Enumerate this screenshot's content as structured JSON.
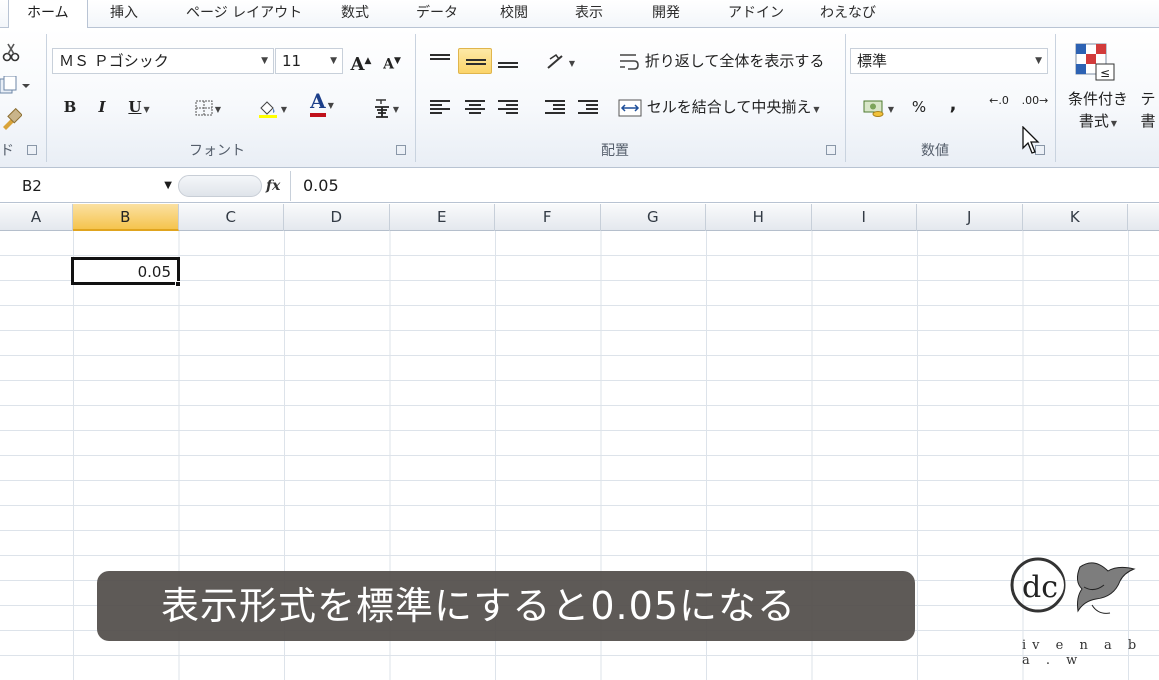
{
  "tabs": [
    "ホーム",
    "挿入",
    "ページ レイアウト",
    "数式",
    "データ",
    "校閲",
    "表示",
    "開発",
    "アドイン",
    "わえなび"
  ],
  "ribbon": {
    "clipboard_label": "ド",
    "font": {
      "name": "ＭＳ Ｐゴシック",
      "size": "11",
      "group_label": "フォント",
      "bold": "B",
      "italic": "I",
      "underline": "U",
      "font_color_letter": "A",
      "grow": "A",
      "shrink": "A"
    },
    "alignment": {
      "wrap_text": "折り返して全体を表示する",
      "merge_center": "セルを結合して中央揃え",
      "group_label": "配置"
    },
    "number": {
      "format": "標準",
      "percent": "%",
      "comma": ",",
      "group_label": "数値",
      "inc_decimal": ".0",
      "dec_decimal": ".00"
    },
    "styles": {
      "conditional_line1": "条件付き",
      "conditional_line2": "書式",
      "table_partial": "テ",
      "table_partial2": "書"
    }
  },
  "formula_bar": {
    "name_box": "B2",
    "fx": "fx",
    "formula": "0.05"
  },
  "columns": [
    "A",
    "B",
    "C",
    "D",
    "E",
    "F",
    "G",
    "H",
    "I",
    "J",
    "K"
  ],
  "selected_column": "B",
  "active_cell": {
    "ref": "B2",
    "value": "0.05"
  },
  "caption": "表示形式を標準にすると0.05になる",
  "logo_text": "iv e n a b a . w",
  "colors": {
    "selection_accent": "#f5c44e",
    "ribbon_bg": "#f7f9fc",
    "caption_bg": "#524e4a"
  }
}
